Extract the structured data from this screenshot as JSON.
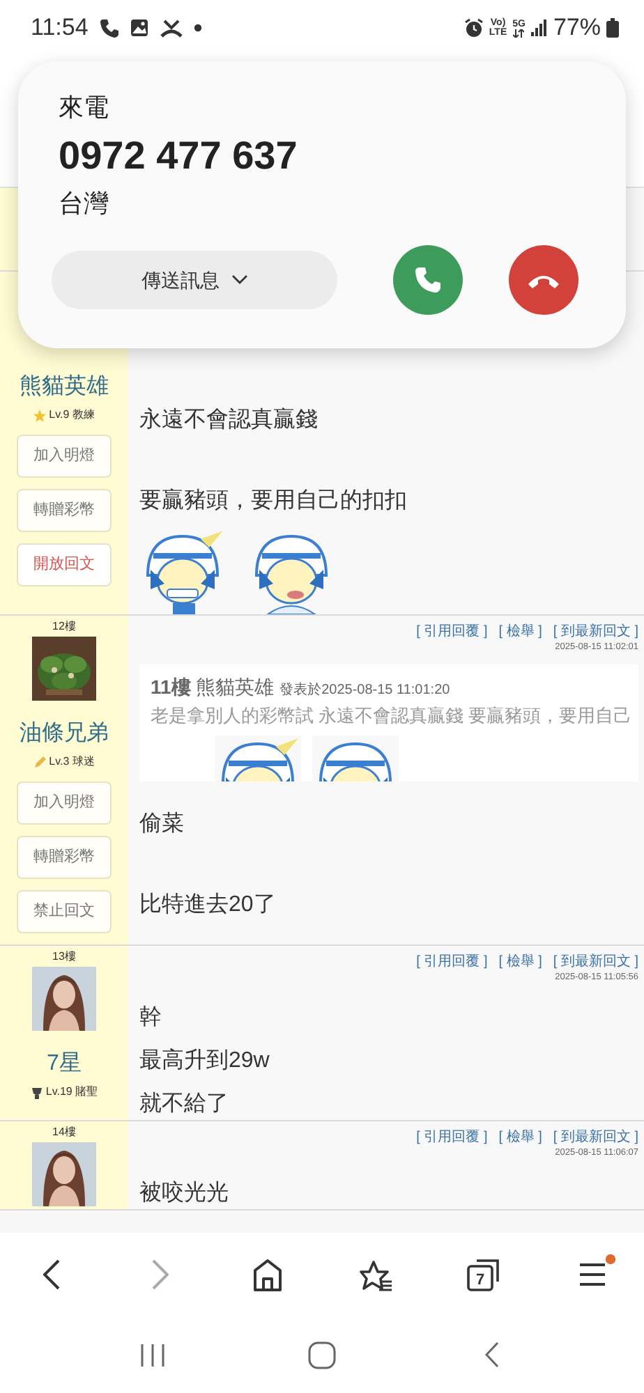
{
  "status_bar": {
    "time": "11:54",
    "volte_top": "Vo)",
    "volte_bottom": "LTE",
    "network": "5G",
    "battery": "77%"
  },
  "incoming_call": {
    "label": "來電",
    "number": "0972 477 637",
    "location": "台灣",
    "message_button": "傳送訊息"
  },
  "posts": [
    {
      "author": "熊貓英雄",
      "badge": {
        "kind": "star"
      },
      "level": "Lv.9 教練",
      "actions": [
        {
          "label": "加入明燈",
          "kind": "normal"
        },
        {
          "label": "轉贈彩幣",
          "kind": "normal"
        },
        {
          "label": "開放回文",
          "kind": "danger"
        }
      ],
      "body": [
        {
          "kind": "text",
          "text": "永遠不會認真贏錢"
        },
        {
          "kind": "text",
          "text": "要贏豬頭，要用自己的扣扣"
        },
        {
          "kind": "stickers"
        }
      ]
    },
    {
      "floor": "12樓",
      "avatar": {
        "kind": "plants"
      },
      "author": "油條兄弟",
      "badge": {
        "kind": "pencil"
      },
      "level": "Lv.3 球迷",
      "links": [
        "[ 引用回覆 ]",
        "[ 檢舉 ]",
        "[ 到最新回文 ]"
      ],
      "timestamp": "2025-08-15 11:02:01",
      "actions": [
        {
          "label": "加入明燈",
          "kind": "normal"
        },
        {
          "label": "轉贈彩幣",
          "kind": "normal"
        },
        {
          "label": "禁止回文",
          "kind": "normal"
        }
      ],
      "quote": {
        "floor": "11樓",
        "author": "熊貓英雄",
        "posted": "發表於2025-08-15 11:01:20",
        "text": "老是拿別人的彩幣試 永遠不會認真贏錢 要贏豬頭，要用自己"
      },
      "body": [
        {
          "kind": "text",
          "text": "偷菜"
        },
        {
          "kind": "text",
          "text": "比特進去20了"
        }
      ]
    },
    {
      "floor": "13樓",
      "avatar": {
        "kind": "person"
      },
      "author": "7星",
      "badge": {
        "kind": "trophy"
      },
      "level": "Lv.19 賭聖",
      "links": [
        "[ 引用回覆 ]",
        "[ 檢舉 ]",
        "[ 到最新回文 ]"
      ],
      "timestamp": "2025-08-15 11:05:56",
      "body": [
        {
          "kind": "line",
          "text": "幹"
        },
        {
          "kind": "line",
          "text": "最高升到29w"
        },
        {
          "kind": "line",
          "text": "就不給了"
        }
      ]
    },
    {
      "floor": "14樓",
      "avatar": {
        "kind": "person"
      },
      "links": [
        "[ 引用回覆 ]",
        "[ 檢舉 ]",
        "[ 到最新回文 ]"
      ],
      "timestamp": "2025-08-15 11:06:07",
      "body": [
        {
          "kind": "line",
          "text": "被咬光光"
        }
      ]
    }
  ],
  "browser_toolbar": {
    "forward_disabled": true,
    "tab_count": "7",
    "menu_badge": true
  }
}
